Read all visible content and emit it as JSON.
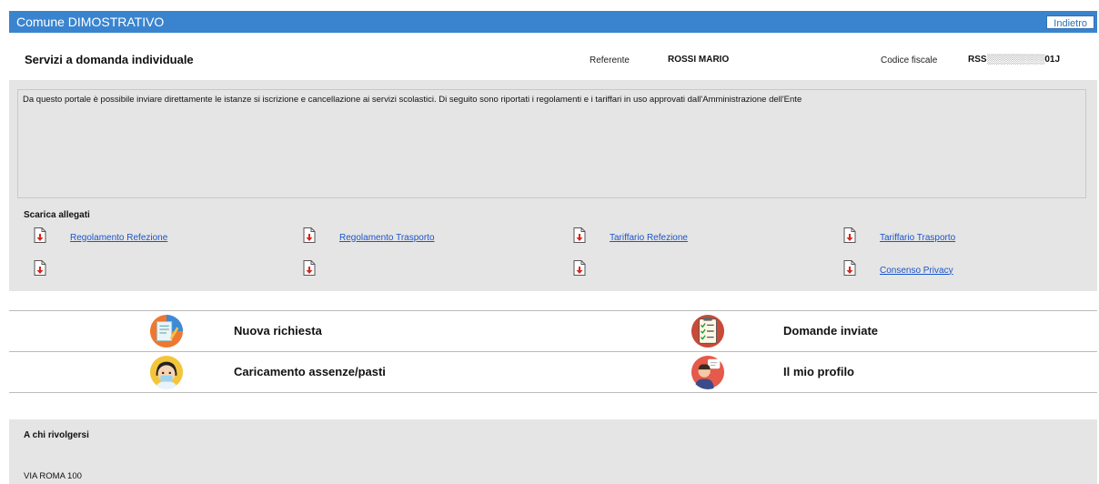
{
  "topbar": {
    "title": "Comune DIMOSTRATIVO",
    "back_label": "Indietro"
  },
  "header": {
    "service_title": "Servizi a domanda individuale",
    "referente_label": "Referente",
    "referente_value": "ROSSI MARIO",
    "cf_label": "Codice fiscale",
    "cf_value": "RSS░░░░░░░░░01J"
  },
  "description": "Da questo portale è possibile inviare direttamente le istanze si iscrizione e cancellazione ai servizi scolastici. Di seguito sono riportati i regolamenti e i tariffari in uso approvati dall'Amministrazione dell'Ente",
  "attachments": {
    "heading": "Scarica allegati",
    "items": [
      {
        "label": "Regolamento Refezione",
        "icon": "pdf-download-icon"
      },
      {
        "label": "Regolamento Trasporto",
        "icon": "pdf-download-icon"
      },
      {
        "label": "Tariffario Refezione",
        "icon": "pdf-download-icon"
      },
      {
        "label": "Tariffario Trasporto",
        "icon": "pdf-download-icon"
      },
      {
        "label": "",
        "icon": "pdf-download-icon"
      },
      {
        "label": "",
        "icon": "pdf-download-icon"
      },
      {
        "label": "",
        "icon": "pdf-download-icon"
      },
      {
        "label": "Consenso Privacy",
        "icon": "pdf-download-icon"
      }
    ]
  },
  "menu": {
    "items": [
      {
        "label": "Nuova richiesta",
        "icon": "new-request-icon"
      },
      {
        "label": "Domande inviate",
        "icon": "sent-applications-icon"
      },
      {
        "label": "Caricamento assenze/pasti",
        "icon": "absences-meals-icon"
      },
      {
        "label": "Il mio profilo",
        "icon": "profile-icon"
      }
    ]
  },
  "footer": {
    "heading": "A chi rivolgersi",
    "address": "VIA ROMA 100"
  },
  "colors": {
    "topbar": "#3a84cf",
    "panel": "#e5e5e5",
    "link": "#1a55c8",
    "pdf_red": "#d9231d"
  }
}
